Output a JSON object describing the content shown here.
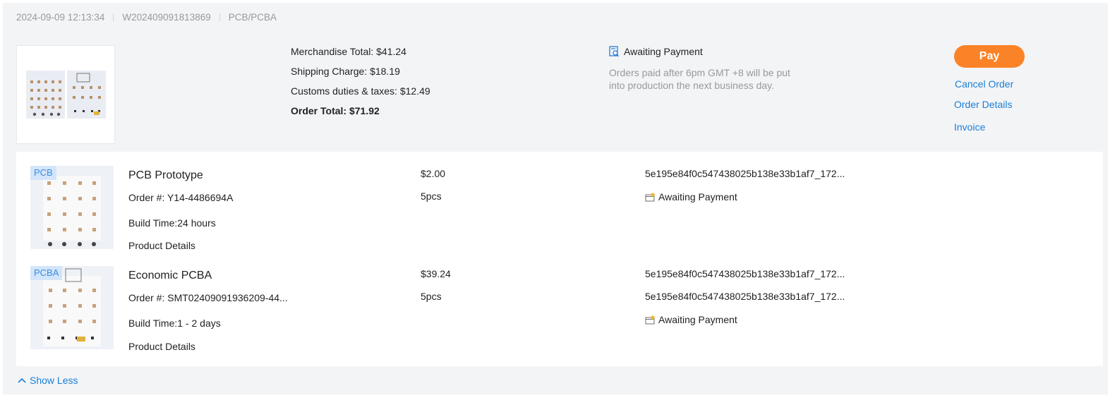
{
  "order": {
    "datetime": "2024-09-09 12:13:34",
    "order_number": "W202409091813869",
    "category": "PCB/PCBA"
  },
  "totals": {
    "merchandise": "Merchandise Total: $41.24",
    "shipping": "Shipping Charge: $18.19",
    "customs": "Customs duties & taxes: $12.49",
    "order_total": "Order Total: $71.92"
  },
  "status": {
    "label": "Awaiting Payment",
    "note": "Orders paid after 6pm GMT +8 will be put into production the next business day.",
    "icon": "search-document-icon"
  },
  "actions": {
    "pay": "Pay",
    "cancel": "Cancel Order",
    "details": "Order Details",
    "invoice": "Invoice"
  },
  "items": [
    {
      "tag": "PCB",
      "name": "PCB Prototype",
      "order_no": "Order #: Y14-4486694A",
      "build_time": "Build Time:24 hours",
      "details_link": "Product Details",
      "price": "$2.00",
      "qty": "5pcs",
      "hashes": [
        "5e195e84f0c547438025b138e33b1af7_172..."
      ],
      "status": "Awaiting Payment"
    },
    {
      "tag": "PCBA",
      "name": "Economic PCBA",
      "order_no": "Order #: SMT02409091936209-44...",
      "build_time": "Build Time:1 - 2 days",
      "details_link": "Product Details",
      "price": "$39.24",
      "qty": "5pcs",
      "hashes": [
        "5e195e84f0c547438025b138e33b1af7_172...",
        "5e195e84f0c547438025b138e33b1af7_172..."
      ],
      "status": "Awaiting Payment"
    }
  ],
  "footer": {
    "show_less": "Show Less"
  },
  "colors": {
    "accent": "#fb8327",
    "link": "#1a7fd6",
    "muted": "#999999",
    "tag_bg": "#d3e5fa"
  }
}
